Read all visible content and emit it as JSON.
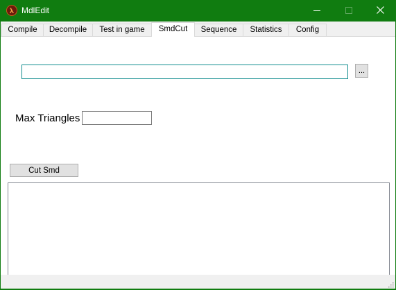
{
  "window": {
    "title": "MdlEdit",
    "accent": "#107c10",
    "app_icon": "half-life-lambda-icon"
  },
  "caption_buttons": {
    "minimize": "minimize-icon",
    "maximize": "maximize-icon",
    "close": "close-icon"
  },
  "tabs": [
    {
      "label": "Compile",
      "active": false
    },
    {
      "label": "Decompile",
      "active": false
    },
    {
      "label": "Test in game",
      "active": false
    },
    {
      "label": "SmdCut",
      "active": true
    },
    {
      "label": "Sequence",
      "active": false
    },
    {
      "label": "Statistics",
      "active": false
    },
    {
      "label": "Config",
      "active": false
    }
  ],
  "smdcut": {
    "path_value": "",
    "browse_label": "...",
    "max_triangles_label": "Max Triangles",
    "max_triangles_value": "",
    "cut_button_label": "Cut Smd",
    "output_text": ""
  }
}
